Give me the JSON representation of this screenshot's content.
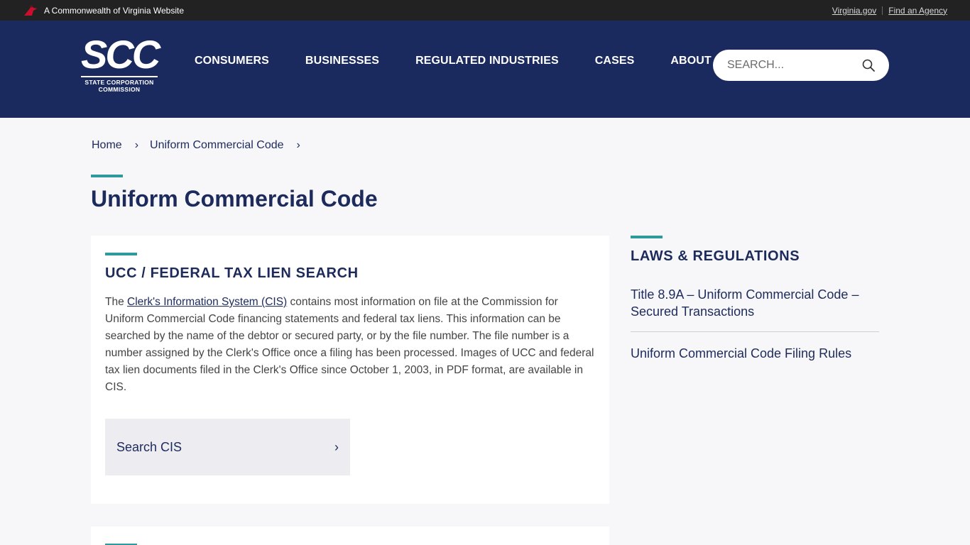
{
  "govbar": {
    "left_text": "A Commonwealth of Virginia Website",
    "links": [
      "Virginia.gov",
      "Find an Agency"
    ]
  },
  "logo": {
    "main": "SCC",
    "line1": "STATE CORPORATION",
    "line2": "COMMISSION"
  },
  "nav": {
    "items": [
      "CONSUMERS",
      "BUSINESSES",
      "REGULATED INDUSTRIES",
      "CASES",
      "ABOUT"
    ]
  },
  "search": {
    "placeholder": "SEARCH..."
  },
  "breadcrumb": {
    "items": [
      "Home",
      "Uniform Commercial Code"
    ]
  },
  "page": {
    "title": "Uniform Commercial Code"
  },
  "main_card": {
    "heading": "UCC / FEDERAL TAX LIEN SEARCH",
    "body_prefix": "The ",
    "body_link": "Clerk's Information System (CIS)",
    "body_suffix": " contains most information on file at the Commission for Uniform Commercial Code financing statements and federal tax liens. This information can be searched by the name of the debtor or secured party, or by the file number. The file number is a number assigned by the Clerk's Office once a filing has been processed. Images of UCC and federal tax lien documents filed in the Clerk's Office since October 1, 2003, in PDF format, are available in CIS.",
    "button_label": "Search CIS"
  },
  "sidebar": {
    "heading": "LAWS & REGULATIONS",
    "links": [
      "Title 8.9A – Uniform Commercial Code – Secured Transactions",
      "Uniform Commercial Code Filing Rules"
    ]
  },
  "colors": {
    "header_bg": "#1b2a5e",
    "accent": "#2e9a9b",
    "govbar_bg": "#222222",
    "cardinal_red": "#c8102e"
  }
}
